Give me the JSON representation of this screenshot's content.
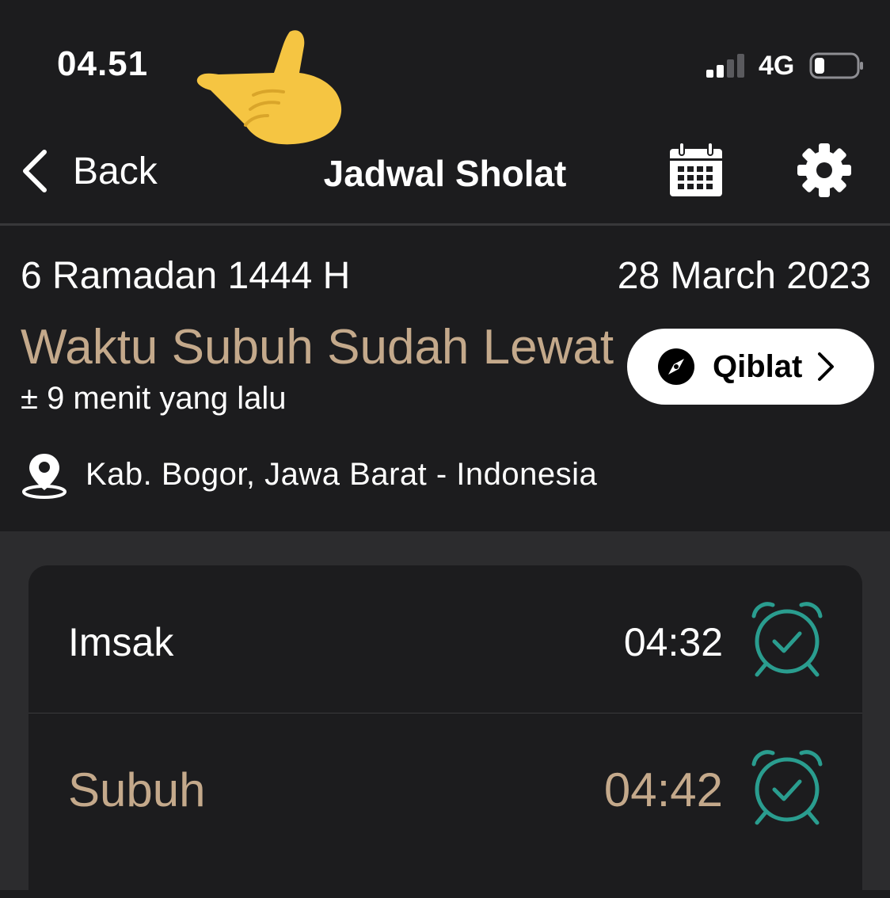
{
  "status_bar": {
    "time": "04.51",
    "network": "4G"
  },
  "nav": {
    "back_label": "Back",
    "title": "Jadwal Sholat"
  },
  "info": {
    "hijri_date": "6 Ramadan 1444 H",
    "gregorian_date": "28 March 2023",
    "headline": "Waktu Subuh Sudah Lewat",
    "subline": "± 9 menit yang lalu",
    "qiblat_label": "Qiblat",
    "location": "Kab. Bogor, Jawa Barat - Indonesia"
  },
  "prayers": [
    {
      "name": "Imsak",
      "time": "04:32",
      "alarm_icon": "alarm-check-icon"
    },
    {
      "name": "Subuh",
      "time": "04:42",
      "alarm_icon": "alarm-check-icon"
    }
  ],
  "colors": {
    "accent_gold": "#c4a98b",
    "alarm_teal": "#2a9d8f",
    "background": "#1c1c1e"
  }
}
